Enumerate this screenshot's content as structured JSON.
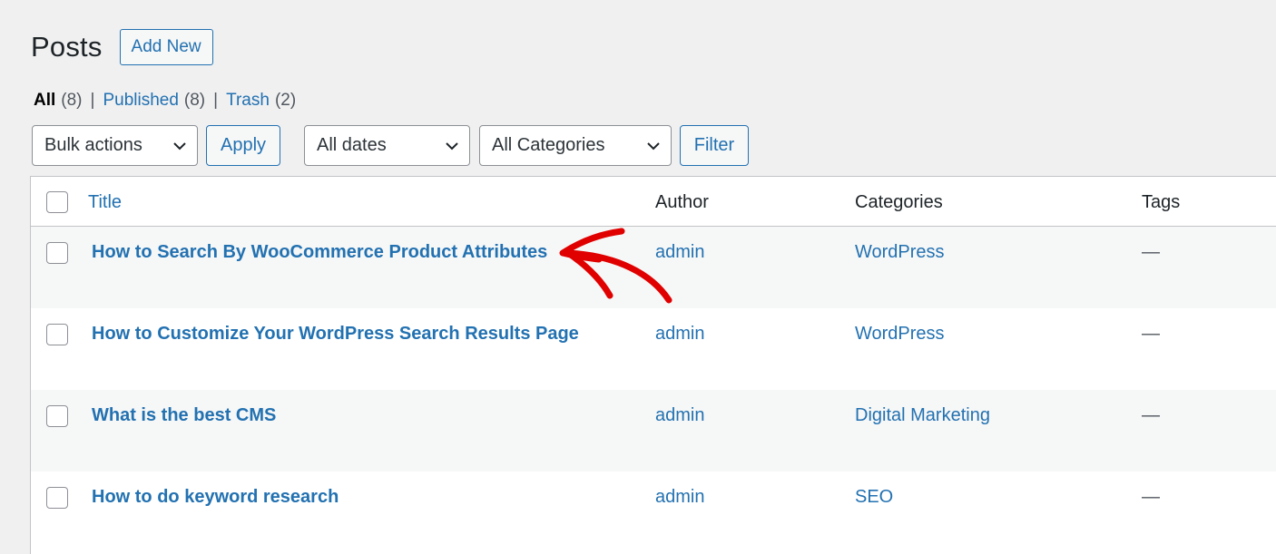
{
  "header": {
    "title": "Posts",
    "add_new_label": "Add New"
  },
  "views": {
    "all": {
      "label": "All",
      "count": "(8)"
    },
    "published": {
      "label": "Published",
      "count": "(8)"
    },
    "trash": {
      "label": "Trash",
      "count": "(2)"
    },
    "separator": "|"
  },
  "filters": {
    "bulk_actions": "Bulk actions",
    "apply_label": "Apply",
    "dates": "All dates",
    "categories": "All Categories",
    "filter_label": "Filter"
  },
  "table": {
    "columns": {
      "title": "Title",
      "author": "Author",
      "categories": "Categories",
      "tags": "Tags"
    },
    "rows": [
      {
        "title": "How to Search By WooCommerce Product Attributes",
        "author": "admin",
        "category": "WordPress",
        "tags": "—"
      },
      {
        "title": "How to Customize Your WordPress Search Results Page",
        "author": "admin",
        "category": "WordPress",
        "tags": "—"
      },
      {
        "title": "What is the best CMS",
        "author": "admin",
        "category": "Digital Marketing",
        "tags": "—"
      },
      {
        "title": "How to do keyword research",
        "author": "admin",
        "category": "SEO",
        "tags": "—"
      }
    ]
  },
  "colors": {
    "link": "#2271b1",
    "background": "#f0f0f1",
    "row_alt": "#f6f7f7",
    "annotation": "#e00000"
  },
  "icons": {
    "select": "chevron-down-icon",
    "annotation": "curved-arrow-icon"
  }
}
